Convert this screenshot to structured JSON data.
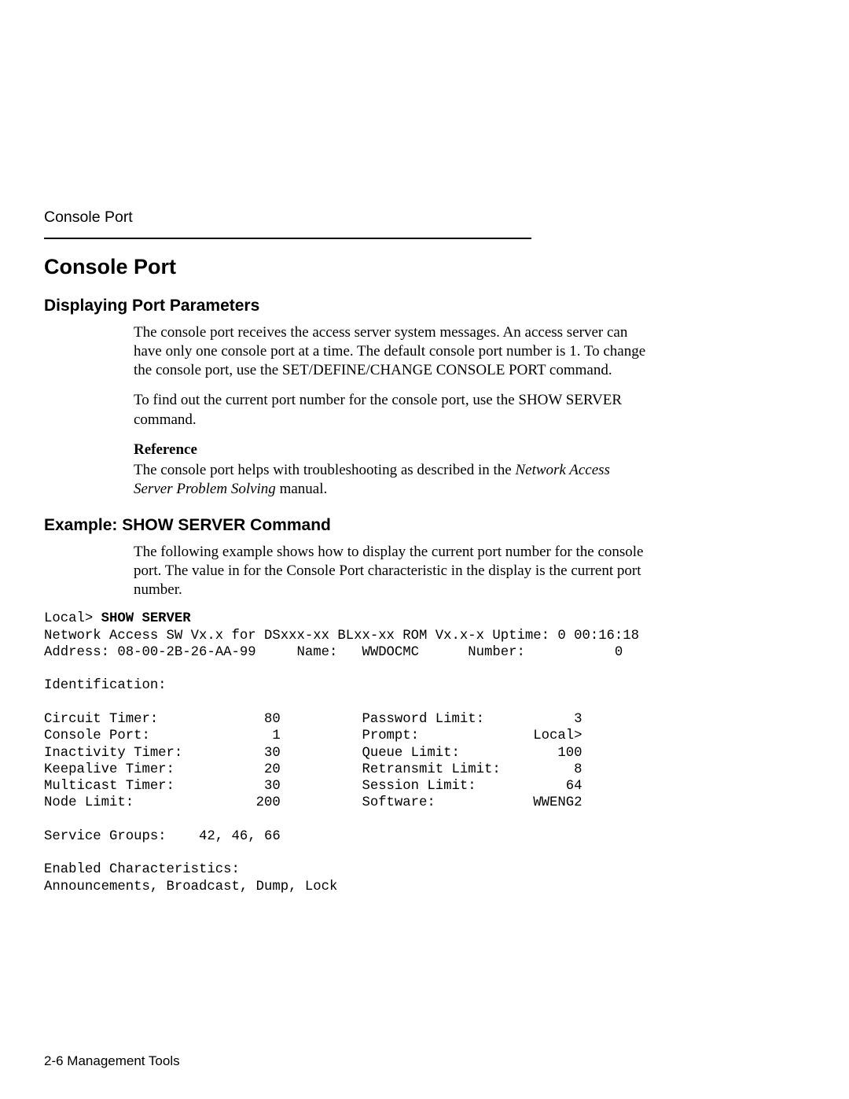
{
  "runningHead": "Console Port",
  "title": "Console Port",
  "section1": {
    "heading": "Displaying Port Parameters",
    "para1": "The console port receives the access server system messages. An access server can have only one console port at a time. The default console port number is 1. To change the console port, use the SET/DEFINE/CHANGE CONSOLE PORT command.",
    "para2": "To find out the current port number for the console port, use the SHOW SERVER command.",
    "refHead": "Reference",
    "refPre": "The console port helps with troubleshooting as described in the ",
    "refItalic": "Network Access Server Problem Solving",
    "refPost": " manual."
  },
  "section2": {
    "heading": "Example:  SHOW SERVER Command",
    "para": "The following example shows how to display the current port number for the console port. The value in for the Console Port characteristic in the display is the current port number."
  },
  "terminal": {
    "promptPre": "Local> ",
    "promptBold": "SHOW SERVER",
    "body": "Network Access SW Vx.x for DSxxx-xx BLxx-xx ROM Vx.x-x Uptime: 0 00:16:18\nAddress: 08-00-2B-26-AA-99     Name:   WWDOCMC      Number:           0\n\nIdentification:\n\nCircuit Timer:             80          Password Limit:           3\nConsole Port:               1          Prompt:              Local>\nInactivity Timer:          30          Queue Limit:            100\nKeepalive Timer:           20          Retransmit Limit:         8\nMulticast Timer:           30          Session Limit:           64\nNode Limit:               200          Software:            WWENG2\n\nService Groups:    42, 46, 66\n\nEnabled Characteristics:\nAnnouncements, Broadcast, Dump, Lock"
  },
  "footer": "2-6  Management Tools",
  "chart_data": {
    "type": "table",
    "title": "SHOW SERVER output characteristics",
    "rows": [
      {
        "label": "Circuit Timer",
        "value": "80"
      },
      {
        "label": "Console Port",
        "value": "1"
      },
      {
        "label": "Inactivity Timer",
        "value": "30"
      },
      {
        "label": "Keepalive Timer",
        "value": "20"
      },
      {
        "label": "Multicast Timer",
        "value": "30"
      },
      {
        "label": "Node Limit",
        "value": "200"
      },
      {
        "label": "Password Limit",
        "value": "3"
      },
      {
        "label": "Prompt",
        "value": "Local>"
      },
      {
        "label": "Queue Limit",
        "value": "100"
      },
      {
        "label": "Retransmit Limit",
        "value": "8"
      },
      {
        "label": "Session Limit",
        "value": "64"
      },
      {
        "label": "Software",
        "value": "WWENG2"
      },
      {
        "label": "Address",
        "value": "08-00-2B-26-AA-99"
      },
      {
        "label": "Name",
        "value": "WWDOCMC"
      },
      {
        "label": "Number",
        "value": "0"
      },
      {
        "label": "Uptime",
        "value": "0 00:16:18"
      },
      {
        "label": "Service Groups",
        "value": "42, 46, 66"
      },
      {
        "label": "Enabled Characteristics",
        "value": "Announcements, Broadcast, Dump, Lock"
      }
    ]
  }
}
